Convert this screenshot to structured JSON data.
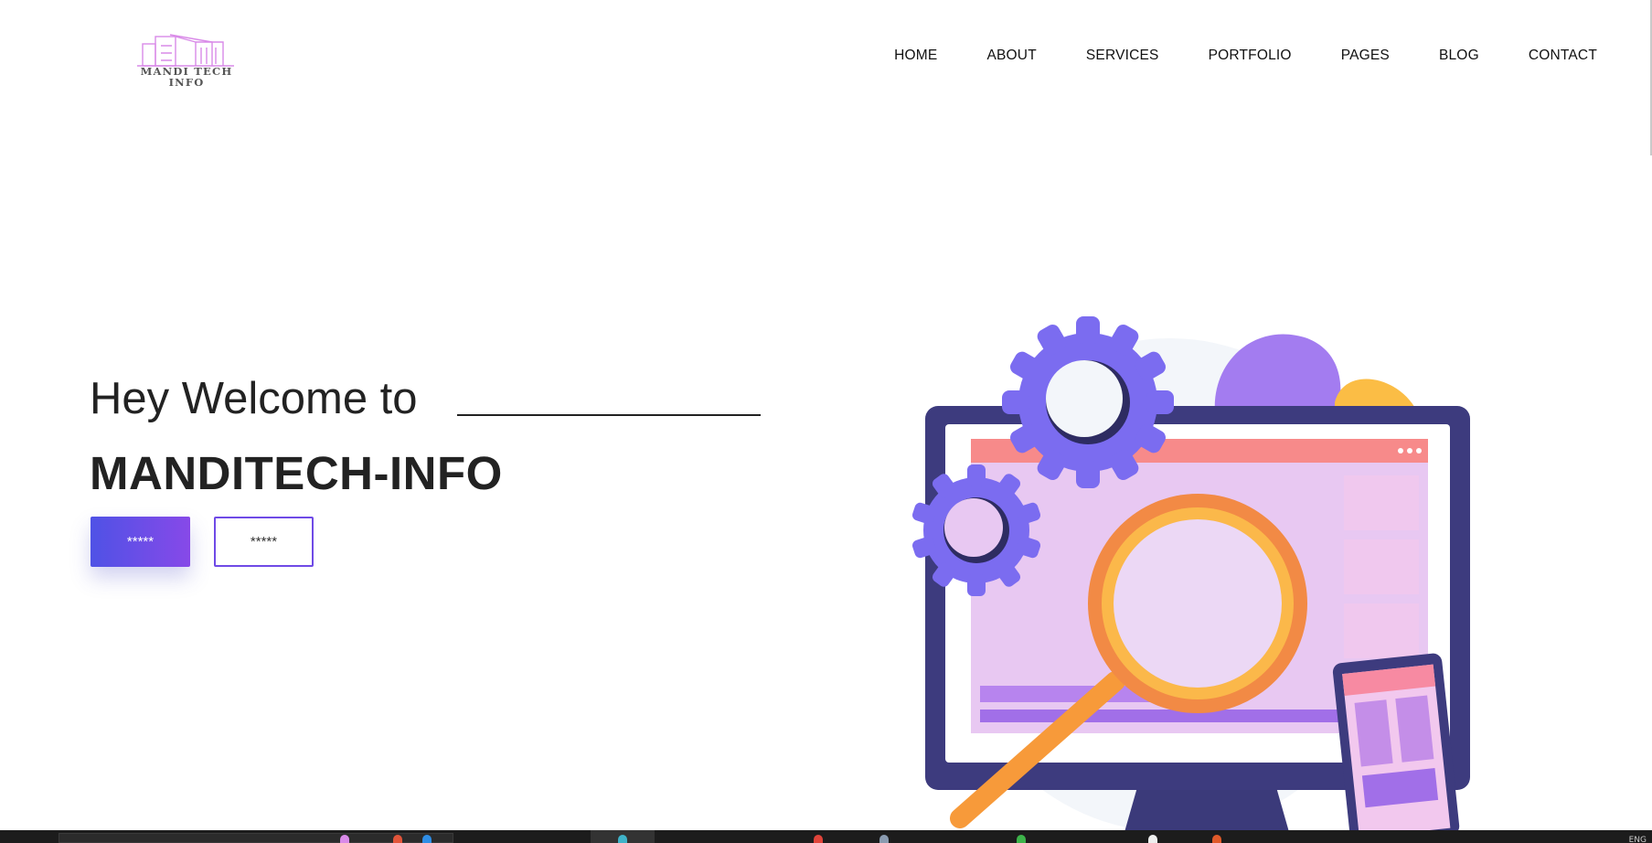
{
  "brand": {
    "logo_text": "MANDI TECH INFO",
    "logo_color": "#d98ae8"
  },
  "nav": {
    "items": [
      {
        "label": "HOME",
        "name": "nav-home"
      },
      {
        "label": "ABOUT",
        "name": "nav-about"
      },
      {
        "label": "SERVICES",
        "name": "nav-services"
      },
      {
        "label": "PORTFOLIO",
        "name": "nav-portfolio"
      },
      {
        "label": "PAGES",
        "name": "nav-pages"
      },
      {
        "label": "BLOG",
        "name": "nav-blog"
      },
      {
        "label": "CONTACT",
        "name": "nav-contact"
      }
    ]
  },
  "hero": {
    "line1": "Hey Welcome to",
    "line2": "MANDITECH-INFO",
    "primary_button": "*****",
    "secondary_button": "*****",
    "illustration": "seo-analysis-monitor-illustration"
  },
  "colors": {
    "accent_start": "#4f52e6",
    "accent_end": "#8749e8",
    "outline": "#6f4ae6",
    "gear": "#7b6cf0",
    "magnifier": "#f7a23b"
  },
  "taskbar": {
    "clock": "ENG"
  }
}
